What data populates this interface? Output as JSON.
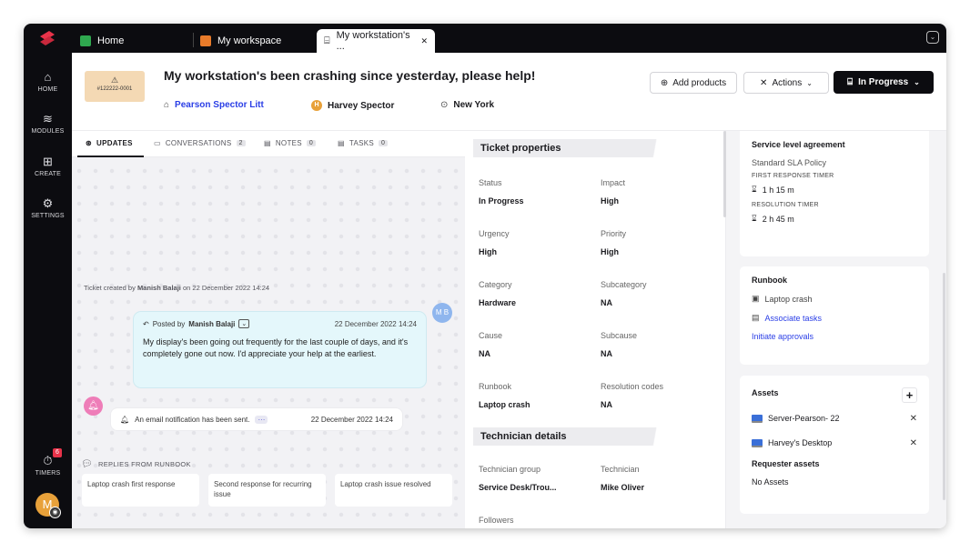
{
  "tabs": [
    {
      "label": "Home",
      "icon": "home-icon",
      "color": "#2fa84f"
    },
    {
      "label": "My workspace",
      "icon": "workspace-icon",
      "color": "#e87b2a"
    },
    {
      "label": "My workstation's ...",
      "icon": "ticket-icon"
    }
  ],
  "tab_close": "✕",
  "sidebar": {
    "items": [
      {
        "label": "HOME",
        "icon": "home-icon"
      },
      {
        "label": "MODULES",
        "icon": "layers-icon"
      },
      {
        "label": "CREATE",
        "icon": "plus-square-icon"
      },
      {
        "label": "SETTINGS",
        "icon": "gear-icon"
      }
    ],
    "timers_label": "TIMERS",
    "timers_badge": "6",
    "avatar_initial": "M"
  },
  "ticket": {
    "id": "#122222-0001",
    "title": "My workstation's been crashing since yesterday, please help!",
    "company": "Pearson Spector Litt",
    "requester": "Harvey Spector",
    "requester_initial": "H",
    "location": "New York"
  },
  "header": {
    "add_products": "Add products",
    "actions": "Actions",
    "status": "In Progress"
  },
  "left_tabs": [
    {
      "label": "UPDATES",
      "count": ""
    },
    {
      "label": "CONVERSATIONS",
      "count": "2"
    },
    {
      "label": "NOTES",
      "count": "0"
    },
    {
      "label": "TASKS",
      "count": "0"
    }
  ],
  "feed": {
    "created_prefix": "Ticket created by",
    "created_by": "Manish Balaji",
    "created_suffix": "on 22 December 2022 14:24",
    "post": {
      "posted_by_label": "Posted by",
      "author": "Manish Balaji",
      "date": "22 December 2022 14:24",
      "text": "My display's been going out frequently for the last couple of days, and it's completely gone out now. I'd appreciate your help at the earliest.",
      "avatar": "M B"
    },
    "notification": {
      "text": "An email notification has been sent.",
      "more": "···",
      "date": "22 December 2022 14:24"
    }
  },
  "replies": {
    "heading": "REPLIES FROM RUNBOOK",
    "cards": [
      "Laptop crash first response",
      "Second response for recurring issue",
      "Laptop crash issue resolved"
    ]
  },
  "properties": {
    "heading": "Ticket properties",
    "fields": [
      {
        "label": "Status",
        "value": "In Progress"
      },
      {
        "label": "Impact",
        "value": "High"
      },
      {
        "label": "Urgency",
        "value": "High"
      },
      {
        "label": "Priority",
        "value": "High"
      },
      {
        "label": "Category",
        "value": "Hardware"
      },
      {
        "label": "Subcategory",
        "value": "NA"
      },
      {
        "label": "Cause",
        "value": "NA"
      },
      {
        "label": "Subcause",
        "value": "NA"
      },
      {
        "label": "Runbook",
        "value": "Laptop crash"
      },
      {
        "label": "Resolution codes",
        "value": "NA"
      }
    ]
  },
  "technician": {
    "heading": "Technician details",
    "fields": [
      {
        "label": "Technician group",
        "value": "Service Desk/Trou..."
      },
      {
        "label": "Technician",
        "value": "Mike Oliver"
      }
    ],
    "followers_label": "Followers"
  },
  "sla": {
    "heading": "Service level agreement",
    "policy": "Standard SLA Policy",
    "first_response_label": "FIRST RESPONSE TIMER",
    "first_response": "1 h 15 m",
    "resolution_label": "RESOLUTION TIMER",
    "resolution": "2 h 45 m"
  },
  "runbook": {
    "heading": "Runbook",
    "item": "Laptop crash",
    "associate": "Associate tasks",
    "approvals": "Initiate approvals"
  },
  "assets": {
    "heading": "Assets",
    "add": "+",
    "items": [
      "Server-Pearson- 22",
      "Harvey's Desktop"
    ],
    "requester_heading": "Requester assets",
    "requester_value": "No Assets"
  },
  "colors": {
    "accent_link": "#2a3ee6",
    "brand": "#e8334a",
    "dark": "#0c0c10"
  }
}
